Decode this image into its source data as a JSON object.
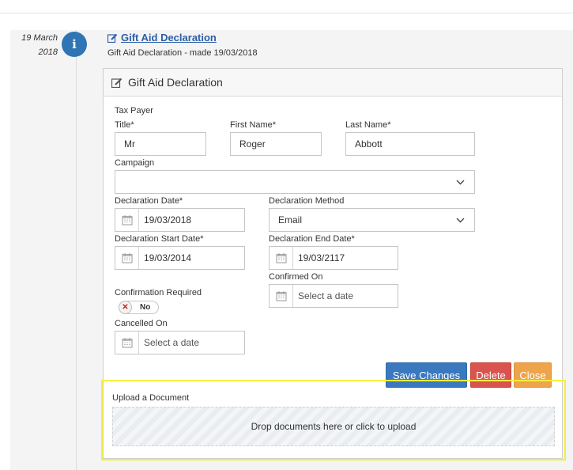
{
  "timeline": {
    "date_line1": "19 March",
    "date_line2": "2018",
    "entry_title": "Gift Aid Declaration",
    "entry_subtitle": "Gift Aid Declaration - made 19/03/2018"
  },
  "panel": {
    "title": "Gift Aid Declaration"
  },
  "form": {
    "section_label": "Tax Payer",
    "title_label": "Title*",
    "title_value": "Mr",
    "first_name_label": "First Name*",
    "first_name_value": "Roger",
    "last_name_label": "Last Name*",
    "last_name_value": "Abbott",
    "campaign_label": "Campaign",
    "campaign_value": "",
    "declaration_date_label": "Declaration Date*",
    "declaration_date_value": "19/03/2018",
    "declaration_method_label": "Declaration Method",
    "declaration_method_value": "Email",
    "declaration_start_label": "Declaration Start Date*",
    "declaration_start_value": "19/03/2014",
    "declaration_end_label": "Declaration End Date*",
    "declaration_end_value": "19/03/2117",
    "confirmed_on_label": "Confirmed On",
    "confirmed_on_placeholder": "Select a date",
    "confirmation_required_label": "Confirmation Required",
    "confirmation_required_state": "No",
    "cancelled_on_label": "Cancelled On",
    "cancelled_on_placeholder": "Select a date"
  },
  "actions": {
    "save_label": "Save Changes",
    "delete_label": "Delete",
    "close_label": "Close"
  },
  "upload": {
    "label": "Upload a Document",
    "dropzone_text": "Drop documents here or click to upload"
  },
  "icons": {
    "info": "info-icon",
    "edit": "edit-icon",
    "calendar": "calendar-icon",
    "chevron": "chevron-down-icon",
    "toggle_off": "x-icon"
  },
  "colors": {
    "save": "#3a78bf",
    "delete": "#d9534f",
    "close": "#eea44a",
    "info": "#2f75b5",
    "link": "#2b5ea8",
    "highlight": "#f6ee3c"
  }
}
